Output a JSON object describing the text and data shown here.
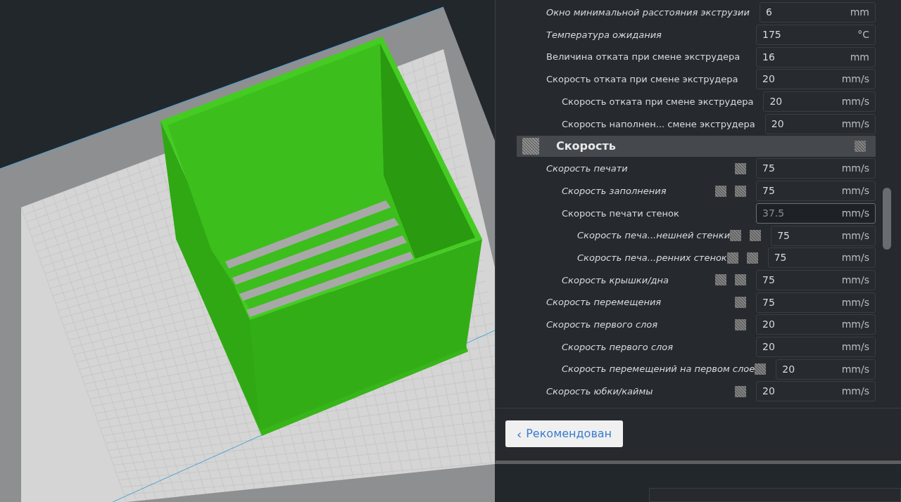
{
  "settings": [
    {
      "kind": "row",
      "label": "Окно минимальной расстояния экструзии",
      "overridden": true,
      "linked": false,
      "reset": false,
      "value": "6",
      "unit": "mm",
      "derived": false
    },
    {
      "kind": "row",
      "label": "Температура ожидания",
      "overridden": true,
      "linked": false,
      "reset": false,
      "value": "175",
      "unit": "°C",
      "derived": false
    },
    {
      "kind": "row",
      "label": "Величина отката при смене экструдера",
      "overridden": false,
      "linked": false,
      "reset": false,
      "value": "16",
      "unit": "mm",
      "derived": false
    },
    {
      "kind": "row",
      "label": "Скорость отката при смене экструдера",
      "overridden": false,
      "linked": false,
      "reset": false,
      "value": "20",
      "unit": "mm/s",
      "derived": false,
      "children": [
        {
          "label": "Скорость отката при смене экструдера",
          "overridden": false,
          "linked": false,
          "reset": false,
          "value": "20",
          "unit": "mm/s",
          "derived": false
        },
        {
          "label": "Скорость наполнен... смене экструдера",
          "overridden": false,
          "linked": false,
          "reset": false,
          "value": "20",
          "unit": "mm/s",
          "derived": false
        }
      ]
    },
    {
      "kind": "header",
      "label": "Скорость"
    },
    {
      "kind": "row",
      "label": "Скорость печати",
      "overridden": true,
      "linked": false,
      "reset": true,
      "value": "75",
      "unit": "mm/s",
      "derived": false,
      "children": [
        {
          "label": "Скорость заполнения",
          "overridden": true,
          "linked": true,
          "reset": true,
          "value": "75",
          "unit": "mm/s",
          "derived": false
        },
        {
          "label": "Скорость печати стенок",
          "overridden": false,
          "linked": false,
          "reset": false,
          "value": "37.5",
          "unit": "mm/s",
          "derived": true,
          "children": [
            {
              "label": "Скорость печа...нешней стенки",
              "overridden": true,
              "linked": true,
              "reset": true,
              "value": "75",
              "unit": "mm/s",
              "derived": false
            },
            {
              "label": "Скорость печа...ренних стенок",
              "overridden": true,
              "linked": true,
              "reset": true,
              "value": "75",
              "unit": "mm/s",
              "derived": false
            }
          ]
        },
        {
          "label": "Скорость крышки/дна",
          "overridden": true,
          "linked": true,
          "reset": true,
          "value": "75",
          "unit": "mm/s",
          "derived": false
        }
      ]
    },
    {
      "kind": "row",
      "label": "Скорость перемещения",
      "overridden": true,
      "linked": false,
      "reset": true,
      "value": "75",
      "unit": "mm/s",
      "derived": false
    },
    {
      "kind": "row",
      "label": "Скорость первого слоя",
      "overridden": true,
      "linked": false,
      "reset": true,
      "value": "20",
      "unit": "mm/s",
      "derived": false,
      "children": [
        {
          "label": "Скорость первого слоя",
          "overridden": true,
          "linked": false,
          "reset": false,
          "value": "20",
          "unit": "mm/s",
          "derived": false
        },
        {
          "label": "Скорость перемещений на первом слое",
          "overridden": true,
          "linked": false,
          "reset": true,
          "value": "20",
          "unit": "mm/s",
          "derived": false
        }
      ]
    },
    {
      "kind": "row",
      "label": "Скорость юбки/каймы",
      "overridden": true,
      "linked": false,
      "reset": true,
      "value": "20",
      "unit": "mm/s",
      "derived": false
    }
  ],
  "back_button": {
    "icon": "‹",
    "label": "Рекомендован"
  }
}
